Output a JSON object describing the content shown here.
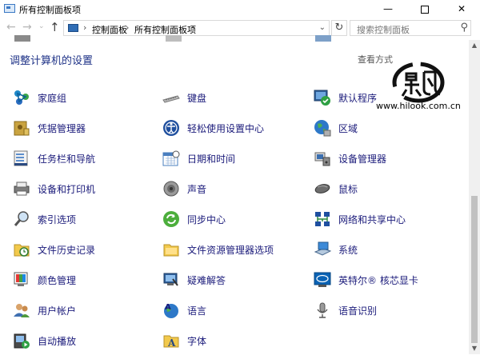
{
  "window": {
    "title": "所有控制面板项",
    "minimize_glyph": "—",
    "close_glyph": "✕"
  },
  "nav": {
    "back_glyph": "←",
    "forward_glyph": "→",
    "recent_glyph": "⌄",
    "up_glyph": "↑",
    "breadcrumbs": [
      "控制面板",
      "所有控制面板项"
    ],
    "separator": "›",
    "dropdown_glyph": "⌄",
    "refresh_glyph": "↻",
    "search_placeholder": "搜索控制面板",
    "search_glyph": "⚲"
  },
  "content": {
    "heading": "调整计算机的设置",
    "view_by": "查看方式"
  },
  "watermark": {
    "url": "www.hilook.com.cn"
  },
  "items": [
    {
      "label": "家庭组",
      "icon": "homegroup-icon"
    },
    {
      "label": "键盘",
      "icon": "keyboard-icon"
    },
    {
      "label": "默认程序",
      "icon": "default-programs-icon"
    },
    {
      "label": "凭据管理器",
      "icon": "credential-manager-icon"
    },
    {
      "label": "轻松使用设置中心",
      "icon": "ease-of-access-icon"
    },
    {
      "label": "区域",
      "icon": "region-icon"
    },
    {
      "label": "任务栏和导航",
      "icon": "taskbar-icon"
    },
    {
      "label": "日期和时间",
      "icon": "date-time-icon"
    },
    {
      "label": "设备管理器",
      "icon": "device-manager-icon"
    },
    {
      "label": "设备和打印机",
      "icon": "devices-printers-icon"
    },
    {
      "label": "声音",
      "icon": "sound-icon"
    },
    {
      "label": "鼠标",
      "icon": "mouse-icon"
    },
    {
      "label": "索引选项",
      "icon": "indexing-options-icon"
    },
    {
      "label": "同步中心",
      "icon": "sync-center-icon"
    },
    {
      "label": "网络和共享中心",
      "icon": "network-sharing-icon"
    },
    {
      "label": "文件历史记录",
      "icon": "file-history-icon"
    },
    {
      "label": "文件资源管理器选项",
      "icon": "file-explorer-options-icon"
    },
    {
      "label": "系统",
      "icon": "system-icon"
    },
    {
      "label": "颜色管理",
      "icon": "color-management-icon"
    },
    {
      "label": "疑难解答",
      "icon": "troubleshooting-icon"
    },
    {
      "label": "英特尔® 核芯显卡",
      "icon": "intel-graphics-icon"
    },
    {
      "label": "用户帐户",
      "icon": "user-accounts-icon"
    },
    {
      "label": "语言",
      "icon": "language-icon"
    },
    {
      "label": "语音识别",
      "icon": "speech-recognition-icon"
    },
    {
      "label": "自动播放",
      "icon": "autoplay-icon"
    },
    {
      "label": "字体",
      "icon": "fonts-icon"
    }
  ],
  "scrollbar": {
    "up_glyph": "▲",
    "down_glyph": "▼"
  },
  "colors": {
    "heading": "#1e3287",
    "item_label": "#1a1a7a",
    "scroll_thumb": "#c1c1c1"
  }
}
